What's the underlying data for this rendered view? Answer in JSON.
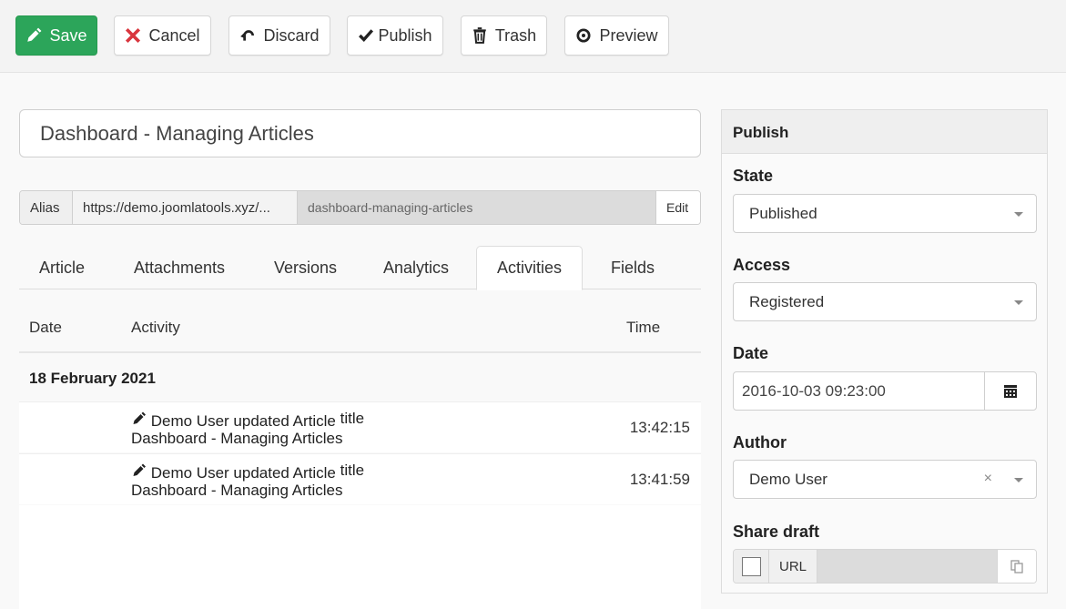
{
  "toolbar": {
    "save": "Save",
    "cancel": "Cancel",
    "discard": "Discard",
    "publish": "Publish",
    "trash": "Trash",
    "preview": "Preview"
  },
  "colors": {
    "save": "#2ca55a",
    "cancel_icon": "#d9363e"
  },
  "title": "Dashboard - Managing Articles",
  "alias": {
    "label": "Alias",
    "base_url": "https://demo.joomlatools.xyz/...",
    "value": "dashboard-managing-articles",
    "edit": "Edit"
  },
  "tabs": [
    {
      "label": "Article"
    },
    {
      "label": "Attachments"
    },
    {
      "label": "Versions"
    },
    {
      "label": "Analytics"
    },
    {
      "label": "Activities",
      "active": true
    },
    {
      "label": "Fields"
    }
  ],
  "table": {
    "headers": {
      "date": "Date",
      "activity": "Activity",
      "time": "Time"
    },
    "group": "18 February 2021",
    "rows": [
      {
        "text": "Demo User updated Article",
        "suffix": "title",
        "object": "Dashboard - Managing Articles",
        "time": "13:42:15"
      },
      {
        "text": "Demo User updated Article",
        "suffix": "title",
        "object": "Dashboard - Managing Articles",
        "time": "13:41:59"
      }
    ]
  },
  "panel": {
    "title": "Publish",
    "state_label": "State",
    "state": "Published",
    "access_label": "Access",
    "access": "Registered",
    "date_label": "Date",
    "date": "2016-10-03 09:23:00",
    "author_label": "Author",
    "author": "Demo User",
    "share_label": "Share draft",
    "url_label": "URL"
  }
}
